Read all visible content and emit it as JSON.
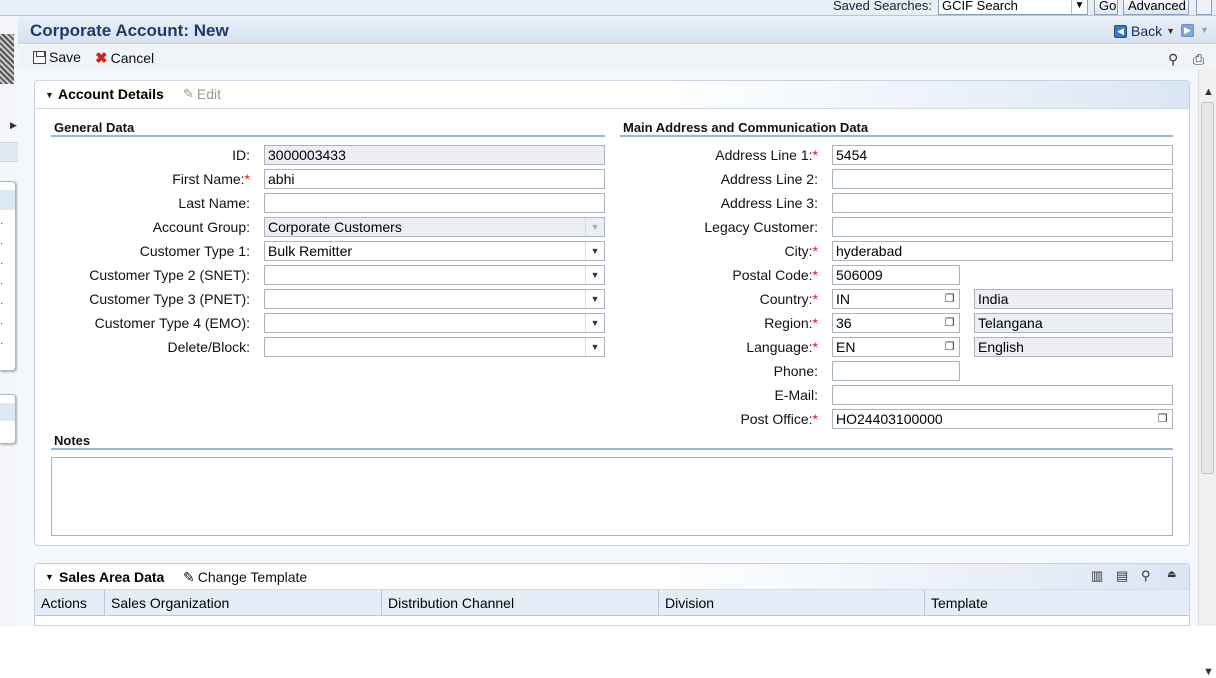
{
  "search": {
    "saved_searches_label": "Saved Searches:",
    "saved_search_value": "GCIF Search",
    "go_label": "Go",
    "advanced_label": "Advanced"
  },
  "header": {
    "title": "Corporate Account: New",
    "back_label": "Back"
  },
  "toolbar": {
    "save_label": "Save",
    "cancel_label": "Cancel"
  },
  "account_details": {
    "title": "Account Details",
    "edit_label": "Edit",
    "general_data": {
      "title": "General Data",
      "id_label": "ID:",
      "id_value": "3000003433",
      "first_name_label": "First Name:",
      "first_name_value": "abhi",
      "last_name_label": "Last Name:",
      "last_name_value": "",
      "account_group_label": "Account Group:",
      "account_group_value": "Corporate Customers",
      "customer_type1_label": "Customer Type 1:",
      "customer_type1_value": "Bulk Remitter",
      "customer_type2_label": "Customer Type 2 (SNET):",
      "customer_type2_value": "",
      "customer_type3_label": "Customer Type 3 (PNET):",
      "customer_type3_value": "",
      "customer_type4_label": "Customer Type 4 (EMO):",
      "customer_type4_value": "",
      "delete_block_label": "Delete/Block:",
      "delete_block_value": ""
    },
    "address": {
      "title": "Main Address and Communication Data",
      "line1_label": "Address Line 1:",
      "line1_value": "5454",
      "line2_label": "Address Line 2:",
      "line2_value": "",
      "line3_label": "Address Line 3:",
      "line3_value": "",
      "legacy_label": "Legacy Customer:",
      "legacy_value": "",
      "city_label": "City:",
      "city_value": "hyderabad",
      "postal_label": "Postal Code:",
      "postal_value": "506009",
      "country_label": "Country:",
      "country_code": "IN",
      "country_name": "India",
      "region_label": "Region:",
      "region_code": "36",
      "region_name": "Telangana",
      "language_label": "Language:",
      "language_code": "EN",
      "language_name": "English",
      "phone_label": "Phone:",
      "phone_value": "",
      "email_label": "E-Mail:",
      "email_value": "",
      "post_office_label": "Post Office:",
      "post_office_value": "HO24403100000"
    },
    "notes": {
      "title": "Notes",
      "value": ""
    },
    "required_marker": "*"
  },
  "sales_area": {
    "title": "Sales Area Data",
    "change_template_label": "Change Template",
    "columns": [
      "Actions",
      "Sales Organization",
      "Distribution Channel",
      "Division",
      "Template"
    ]
  }
}
